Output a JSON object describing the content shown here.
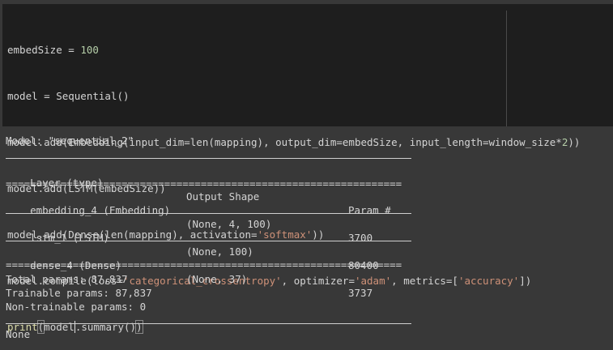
{
  "code_cell": {
    "lines": [
      {
        "pre": "embedSize = ",
        "num": "100"
      },
      {
        "text": "model = Sequential()"
      },
      {
        "pre": "model.add(Embedding(input_dim=len(mapping), output_dim=embedSize, input_length=window_size*",
        "num": "2",
        "post": "))"
      },
      {
        "text": "model.add(LSTM(embedSize))"
      },
      {
        "pre": "model.add(Dense(len(mapping), activation=",
        "str": "'softmax'",
        "post": "))"
      },
      {
        "pre": "model.compile(loss=",
        "str1": "'categorical_crossentropy'",
        "mid1": ", optimizer=",
        "str2": "'adam'",
        "mid2": ", metrics=[",
        "str3": "'accuracy'",
        "post": "])"
      },
      {
        "fn": "print",
        "p1": "(",
        "a": "model",
        "b": ".summary()",
        "p2": ")"
      }
    ]
  },
  "output": {
    "model_line": "Model: \"sequential_2\"",
    "headers": {
      "layer": "Layer (type)",
      "shape": "Output Shape",
      "param": "Param #"
    },
    "separator": "=================================================================",
    "rows": [
      {
        "layer": "embedding_4 (Embedding)",
        "shape": "(None, 4, 100)",
        "param": "3700"
      },
      {
        "layer": "lstm_1 (LSTM)",
        "shape": "(None, 100)",
        "param": "80400"
      },
      {
        "layer": "dense_4 (Dense)",
        "shape": "(None, 37)",
        "param": "3737"
      }
    ],
    "total": "Total params: 87,837",
    "trainable": "Trainable params: 87,837",
    "non_trainable": "Non-trainable params: 0",
    "return_value": "None"
  }
}
